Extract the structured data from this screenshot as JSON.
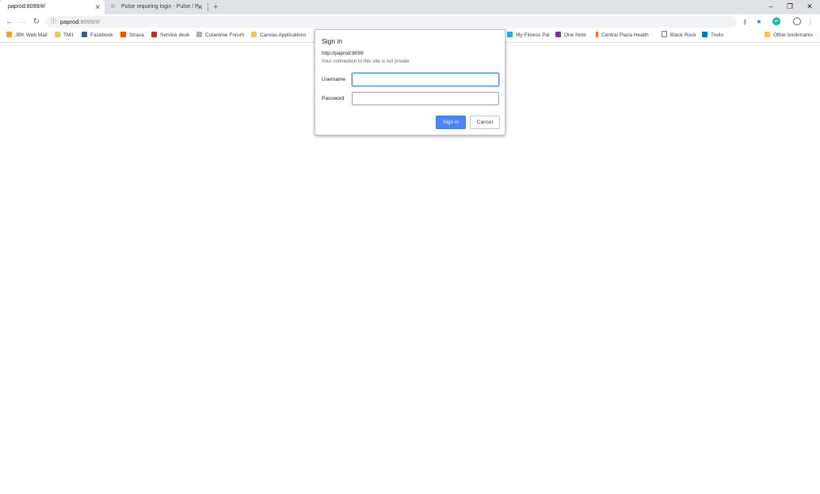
{
  "tabs": [
    {
      "title": "paprod:8099/#/",
      "active": true
    },
    {
      "title": "Pulse requiring login - Pulse / P...",
      "active": false
    }
  ],
  "window_controls": {
    "minimize": "–",
    "restore": "❐",
    "close": "✕"
  },
  "omnibox": {
    "host": "paprod",
    "path": ":8099/#/"
  },
  "bookmarks": [
    {
      "label": "JBK Web Mail",
      "icon": "mail-icon"
    },
    {
      "label": "TM1",
      "icon": "folder-icon"
    },
    {
      "label": "Facebook",
      "icon": "facebook-icon"
    },
    {
      "label": "Strava",
      "icon": "strava-icon"
    },
    {
      "label": "Service desk",
      "icon": "service-desk-icon"
    },
    {
      "label": "Cubewise Forum",
      "icon": "forum-icon"
    },
    {
      "label": "Canvas Applications",
      "icon": "folder-icon"
    },
    {
      "label": "My Fitness Pal",
      "icon": "fitness-icon"
    },
    {
      "label": "One Note",
      "icon": "onenote-icon"
    },
    {
      "label": "Central Plaza Health",
      "icon": "flag-icon"
    },
    {
      "label": "Black Rock",
      "icon": "page-icon"
    },
    {
      "label": "Trello",
      "icon": "trello-icon"
    },
    {
      "label": "Other bookmarks",
      "icon": "folder-icon"
    }
  ],
  "dialog": {
    "title": "Sign in",
    "url": "http://paprod:8099",
    "note": "Your connection to this site is not private",
    "username_label": "Username",
    "username_value": "",
    "password_label": "Password",
    "password_value": "",
    "sign_in_label": "Sign in",
    "cancel_label": "Cancel"
  },
  "colors": {
    "accent": "#4a86f7",
    "tabstrip": "#dee1e6",
    "star": "#1a73e8"
  }
}
